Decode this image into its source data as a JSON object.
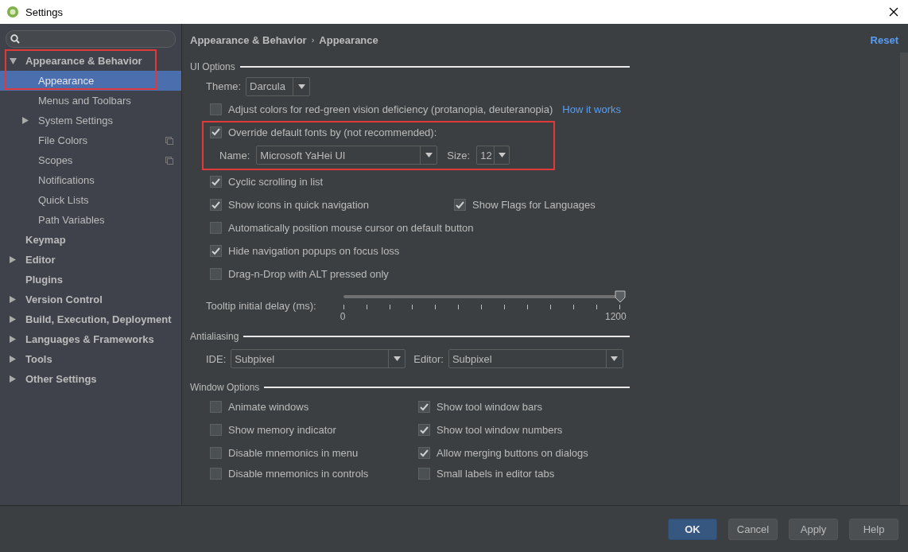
{
  "window": {
    "title": "Settings"
  },
  "sidebar": {
    "items": [
      {
        "label": "Appearance & Behavior",
        "expanded": true,
        "highlighted": true,
        "children": [
          {
            "label": "Appearance",
            "selected": true
          },
          {
            "label": "Menus and Toolbars",
            "selected": false
          },
          {
            "label": "System Settings",
            "selected": false,
            "expanded": false
          },
          {
            "label": "File Colors",
            "selected": false,
            "project_level": true
          },
          {
            "label": "Scopes",
            "selected": false,
            "project_level": true
          },
          {
            "label": "Notifications",
            "selected": false
          },
          {
            "label": "Quick Lists",
            "selected": false
          },
          {
            "label": "Path Variables",
            "selected": false
          }
        ]
      },
      {
        "label": "Keymap",
        "selected": false
      },
      {
        "label": "Editor",
        "selected": false,
        "expanded": false
      },
      {
        "label": "Plugins",
        "selected": false
      },
      {
        "label": "Version Control",
        "selected": false,
        "expanded": false
      },
      {
        "label": "Build, Execution, Deployment",
        "selected": false,
        "expanded": false
      },
      {
        "label": "Languages & Frameworks",
        "selected": false,
        "expanded": false
      },
      {
        "label": "Tools",
        "selected": false,
        "expanded": false
      },
      {
        "label": "Other Settings",
        "selected": false,
        "expanded": false
      }
    ]
  },
  "breadcrumb": [
    "Appearance & Behavior",
    "Appearance"
  ],
  "breadcrumb_separator": "›",
  "reset": "Reset",
  "ui_options": {
    "title": "UI Options",
    "theme": {
      "label": "Theme:",
      "value": "Darcula"
    },
    "color_adjust": {
      "label": "Adjust colors for red-green vision deficiency (protanopia, deuteranopia)",
      "checked": false,
      "link": "How it works"
    },
    "override_fonts": {
      "label": "Override default fonts by (not recommended):",
      "checked": true,
      "highlighted": true,
      "name_label": "Name:",
      "name_value": "Microsoft YaHei UI",
      "size_label": "Size:",
      "size_value": "12"
    },
    "rows": [
      [
        {
          "label": "Cyclic scrolling in list",
          "checked": true
        }
      ],
      [
        {
          "label": "Show icons in quick navigation",
          "checked": true
        },
        {
          "label": "Show Flags for Languages",
          "checked": true
        }
      ],
      [
        {
          "label": "Automatically position mouse cursor on default button",
          "checked": false
        }
      ],
      [
        {
          "label": "Hide navigation popups on focus loss",
          "checked": true
        }
      ],
      [
        {
          "label": "Drag-n-Drop with ALT pressed only",
          "checked": false
        }
      ]
    ],
    "tooltip_delay": {
      "label": "Tooltip initial delay (ms):",
      "level": 1,
      "min": "0",
      "max": "1200"
    }
  },
  "antialiasing": {
    "title": "Antialiasing",
    "ide_label": "IDE:",
    "ide_value": "Subpixel",
    "editor_label": "Editor:",
    "editor_value": "Subpixel"
  },
  "window_options": {
    "title": "Window Options",
    "rows": [
      [
        {
          "label": "Animate windows",
          "checked": false
        },
        {
          "label": "Show tool window bars",
          "checked": true
        }
      ],
      [
        {
          "label": "Show memory indicator",
          "checked": false
        },
        {
          "label": "Show tool window numbers",
          "checked": true
        }
      ],
      [
        {
          "label": "Disable mnemonics in menu",
          "checked": false
        },
        {
          "label": "Allow merging buttons on dialogs",
          "checked": true
        }
      ],
      [
        {
          "label": "Disable mnemonics in controls",
          "checked": false
        },
        {
          "label": "Small labels in editor tabs",
          "checked": false
        }
      ]
    ]
  },
  "buttons": [
    {
      "label": "OK",
      "kind": "primary"
    },
    {
      "label": "Cancel",
      "kind": "normal"
    },
    {
      "label": "Apply",
      "kind": "normal"
    },
    {
      "label": "Help",
      "kind": "normal"
    }
  ]
}
